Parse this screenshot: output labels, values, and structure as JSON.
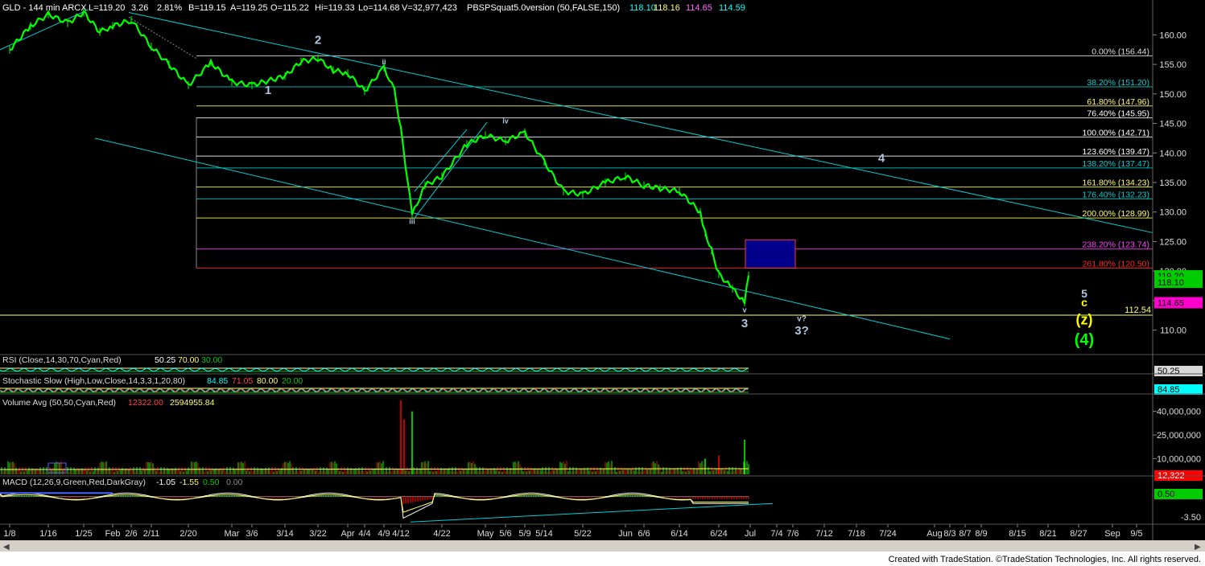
{
  "header": {
    "items": [
      {
        "text": "GLD - 144 min  ARCX",
        "color": "#ffffff"
      },
      {
        "text": "L=119.20",
        "color": "#ffffff"
      },
      {
        "text": "3.26",
        "color": "#ffffff"
      },
      {
        "text": "2.81%",
        "color": "#ffffff"
      },
      {
        "text": "B=119.15",
        "color": "#ffffff"
      },
      {
        "text": "A=119.25",
        "color": "#ffffff"
      },
      {
        "text": "O=115.22",
        "color": "#ffffff"
      },
      {
        "text": "Hi=119.33",
        "color": "#ffffff"
      },
      {
        "text": "Lo=114.68",
        "color": "#ffffff"
      },
      {
        "text": "V=32,977,423",
        "color": "#ffffff"
      },
      {
        "text": "PBSPSquat5.0version (50,FALSE,150)",
        "color": "#ffffff"
      },
      {
        "text": "118.10",
        "color": "#00ffff"
      },
      {
        "text": "118.16",
        "color": "#ffff66"
      },
      {
        "text": "114.65",
        "color": "#ff66ff"
      },
      {
        "text": "114.59",
        "color": "#00ffff"
      }
    ]
  },
  "colors": {
    "background": "#000000",
    "candles": "#00ff00",
    "trendline": "#00ced1",
    "fib_cyan": "#00ced1",
    "fib_yellow": "#ffff66",
    "fib_pink": "#ff44ff",
    "fib_red": "#ff2222",
    "wave_label": "#b0c4de",
    "target_box": "#00008b",
    "target_box_border": "#ff3333",
    "last_price": "#00cc00",
    "pink_marker": "#ff00cc"
  },
  "chart_data": [
    {
      "type": "line",
      "title": "GLD - 144 min ARCX",
      "ylim": [
        106,
        164
      ],
      "y_ticks": [
        "160.00",
        "155.00",
        "150.00",
        "145.00",
        "140.00",
        "135.00",
        "130.00",
        "125.00",
        "120.00",
        "115.00",
        "110.00"
      ],
      "y_tick_values": [
        160,
        155,
        150,
        145,
        140,
        135,
        130,
        125,
        120,
        115,
        110
      ],
      "x_tick_labels": [
        "1/8",
        "1/16",
        "1/25",
        "Feb",
        "2/6",
        "2/11",
        "2/20",
        "Mar",
        "3/6",
        "3/14",
        "3/22",
        "Apr",
        "4/4",
        "4/9",
        "4/12",
        "4/22",
        "May",
        "5/6",
        "5/9",
        "5/14",
        "5/22",
        "Jun",
        "6/6",
        "6/14",
        "6/24",
        "Jul",
        "7/4",
        "7/6",
        "7/12",
        "7/18",
        "7/24",
        "Aug",
        "8/3",
        "8/7",
        "8/9",
        "8/15",
        "8/21",
        "8/27",
        "Sep",
        "9/5"
      ],
      "price_path": [
        {
          "d": "1/8",
          "v": 157.5
        },
        {
          "d": "1/12",
          "v": 161.5
        },
        {
          "d": "1/16",
          "v": 163.5
        },
        {
          "d": "1/20",
          "v": 162.0
        },
        {
          "d": "1/25",
          "v": 163.8
        },
        {
          "d": "1/29",
          "v": 160.5
        },
        {
          "d": "Feb",
          "v": 161.5
        },
        {
          "d": "2/6",
          "v": 162.5
        },
        {
          "d": "2/11",
          "v": 158.0
        },
        {
          "d": "2/15",
          "v": 155.0
        },
        {
          "d": "2/20",
          "v": 151.5
        },
        {
          "d": "2/24",
          "v": 155.3
        },
        {
          "d": "Mar",
          "v": 152.0
        },
        {
          "d": "3/6",
          "v": 151.5
        },
        {
          "d": "3/14",
          "v": 153.0
        },
        {
          "d": "3/18",
          "v": 155.5
        },
        {
          "d": "3/22",
          "v": 156.0
        },
        {
          "d": "3/28",
          "v": 154.0
        },
        {
          "d": "Apr",
          "v": 153.5
        },
        {
          "d": "4/4",
          "v": 150.5
        },
        {
          "d": "4/9",
          "v": 154.5
        },
        {
          "d": "4/11",
          "v": 150.5
        },
        {
          "d": "4/12",
          "v": 144.0
        },
        {
          "d": "4/15",
          "v": 129.5
        },
        {
          "d": "4/18",
          "v": 134.5
        },
        {
          "d": "4/22",
          "v": 136.0
        },
        {
          "d": "4/28",
          "v": 141.5
        },
        {
          "d": "May",
          "v": 143.0
        },
        {
          "d": "5/6",
          "v": 142.0
        },
        {
          "d": "5/9",
          "v": 143.5
        },
        {
          "d": "5/14",
          "v": 138.5
        },
        {
          "d": "5/18",
          "v": 133.5
        },
        {
          "d": "5/22",
          "v": 133.0
        },
        {
          "d": "5/28",
          "v": 135.0
        },
        {
          "d": "Jun",
          "v": 136.0
        },
        {
          "d": "6/6",
          "v": 134.5
        },
        {
          "d": "6/10",
          "v": 134.0
        },
        {
          "d": "6/14",
          "v": 133.5
        },
        {
          "d": "6/18",
          "v": 130.0
        },
        {
          "d": "6/20",
          "v": 126.5
        },
        {
          "d": "6/22",
          "v": 123.5
        },
        {
          "d": "6/24",
          "v": 119.5
        },
        {
          "d": "6/26",
          "v": 117.0
        },
        {
          "d": "6/27",
          "v": 114.7
        },
        {
          "d": "6/28",
          "v": 119.2
        }
      ],
      "fib_levels": [
        {
          "label": "0.00% (156.44)",
          "value": 156.44,
          "color": "#dddddd"
        },
        {
          "label": "38.20% (151.20)",
          "value": 151.2,
          "color": "#00ced1"
        },
        {
          "label": "61.80% (147.96)",
          "value": 147.96,
          "color": "#ffff66"
        },
        {
          "label": "76.40% (145.95)",
          "value": 145.95,
          "color": "#ffffff"
        },
        {
          "label": "100.00% (142.71)",
          "value": 142.71,
          "color": "#ffffff"
        },
        {
          "label": "123.60% (139.47)",
          "value": 139.47,
          "color": "#ffffff"
        },
        {
          "label": "138.20% (137.47)",
          "value": 137.47,
          "color": "#00ced1"
        },
        {
          "label": "161.80% (134.23)",
          "value": 134.23,
          "color": "#ffff66"
        },
        {
          "label": "176.40% (132.23)",
          "value": 132.23,
          "color": "#00ced1"
        },
        {
          "label": "200.00% (128.99)",
          "value": 128.99,
          "color": "#ffff66"
        },
        {
          "label": "238.20% (123.74)",
          "value": 123.74,
          "color": "#ff44ff"
        },
        {
          "label": "261.80% (120.50)",
          "value": 120.5,
          "color": "#ff2222"
        }
      ],
      "horizontal_line": {
        "label": "112.54",
        "value": 112.54,
        "color": "#ffff66"
      },
      "price_boxes": [
        {
          "label": "119.20",
          "value": 119.2,
          "bg": "#00cc00",
          "fg": "#000000"
        },
        {
          "label": "118.10",
          "value": 118.1,
          "bg": "#00cc00",
          "fg": "#000000"
        },
        {
          "label": "114.65",
          "value": 114.65,
          "bg": "#ff00cc",
          "fg": "#000000"
        }
      ],
      "wave_labels": [
        {
          "text": "1",
          "d": "3/10",
          "v": 150.0,
          "color": "#b0c4de",
          "size": 15
        },
        {
          "text": "2",
          "d": "3/22",
          "v": 158.5,
          "color": "#b0c4de",
          "size": 15
        },
        {
          "text": "ii",
          "d": "4/9",
          "v": 155.0,
          "color": "#b0c4de",
          "size": 9
        },
        {
          "text": "iii",
          "d": "4/15",
          "v": 128.0,
          "color": "#b0c4de",
          "size": 9
        },
        {
          "text": "iv",
          "d": "5/6",
          "v": 145.0,
          "color": "#b0c4de",
          "size": 9
        },
        {
          "text": "v",
          "d": "6/27",
          "v": 113.0,
          "color": "#b0c4de",
          "size": 9
        },
        {
          "text": "3",
          "d": "6/27",
          "v": 110.5,
          "color": "#b0c4de",
          "size": 15
        },
        {
          "text": "v?",
          "d": "7/12",
          "v": 111.5,
          "color": "#b0c4de",
          "size": 10
        },
        {
          "text": "3?",
          "d": "7/12",
          "v": 109.3,
          "color": "#b0c4de",
          "size": 15
        },
        {
          "text": "4",
          "d": "7/24",
          "v": 138.5,
          "color": "#b0c4de",
          "size": 15
        },
        {
          "text": "5",
          "d": "8/27",
          "v": 115.5,
          "color": "#b0c4de",
          "size": 14
        },
        {
          "text": "c",
          "d": "8/27",
          "v": 114.0,
          "color": "#ffff00",
          "size": 14
        },
        {
          "text": "(z)",
          "d": "8/27",
          "v": 111.0,
          "color": "#ffff00",
          "size": 18
        },
        {
          "text": "(4)",
          "d": "8/27",
          "v": 107.5,
          "color": "#00ff00",
          "size": 20
        }
      ],
      "target_box": {
        "d_from": "6/29",
        "d_to": "7/6",
        "v_top": 125.3,
        "v_bottom": 120.5
      }
    },
    {
      "type": "line",
      "title": "RSI (Close,14,30,70,Cyan,Red)",
      "legend": [
        {
          "text": "50.25",
          "color": "#ffffff"
        },
        {
          "text": "70.00",
          "color": "#ffff66"
        },
        {
          "text": "30.00",
          "color": "#00cc00"
        }
      ],
      "last_value_box": {
        "label": "50.25",
        "bg": "#d8d8d8",
        "fg": "#000000"
      }
    },
    {
      "type": "line",
      "title": "Stochastic Slow (High,Low,Close,14,3,3,1,20,80)",
      "legend": [
        {
          "text": "84.85",
          "color": "#00ffff"
        },
        {
          "text": "71.05",
          "color": "#ff4444"
        },
        {
          "text": "80.00",
          "color": "#ffff66"
        },
        {
          "text": "20.00",
          "color": "#00cc00"
        }
      ],
      "last_value_box": {
        "label": "84.85",
        "bg": "#00ffff",
        "fg": "#000000"
      }
    },
    {
      "type": "bar",
      "title": "Volume Avg (50,50,Cyan,Red)",
      "legend": [
        {
          "text": "12322.00",
          "color": "#ff4444"
        },
        {
          "text": "2594955.84",
          "color": "#ffff66"
        }
      ],
      "y_ticks": [
        "40,000,000",
        "25,000,000",
        "10,000,000"
      ],
      "y_tick_values": [
        40000000,
        25000000,
        10000000
      ],
      "ylim": [
        0,
        48000000
      ],
      "spikes": [
        {
          "d": "4/12",
          "v": 47000000
        },
        {
          "d": "4/15",
          "v": 40000000
        },
        {
          "d": "4/12",
          "v": 35000000
        },
        {
          "d": "6/27",
          "v": 22000000
        },
        {
          "d": "6/24",
          "v": 12000000
        },
        {
          "d": "6/20",
          "v": 10000000
        }
      ],
      "value_boxes": [
        {
          "label": "12,322",
          "bg": "#ff0000",
          "fg": "#ffffff"
        }
      ]
    },
    {
      "type": "line",
      "title": "MACD (12,26,9,Green,Red,DarkGray)",
      "legend": [
        {
          "text": "-1.05",
          "color": "#ffffff"
        },
        {
          "text": "-1.55",
          "color": "#ffff66"
        },
        {
          "text": "0.50",
          "color": "#00cc00"
        },
        {
          "text": "0.00",
          "color": "#888888"
        }
      ],
      "y_ticks": [
        "-3.50"
      ],
      "y_tick_values": [
        -3.5
      ],
      "ylim": [
        -4.5,
        3
      ],
      "value_boxes": [
        {
          "label": "0.50",
          "bg": "#00cc00",
          "fg": "#000000"
        }
      ]
    }
  ],
  "footer": {
    "credit": "Created with TradeStation. ©TradeStation Technologies, Inc. All rights reserved."
  }
}
